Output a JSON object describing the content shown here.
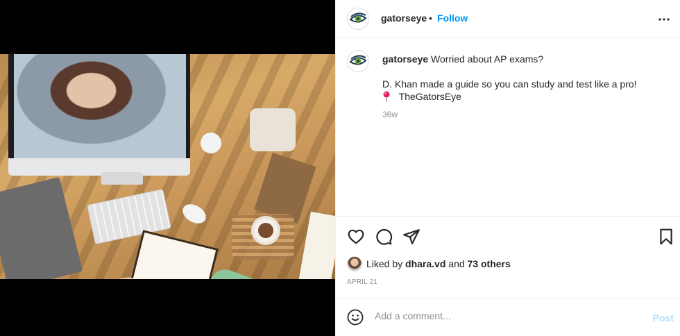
{
  "header": {
    "username": "gatorseye",
    "separator": "•",
    "follow_label": "Follow",
    "more_icon": "more-horizontal-icon"
  },
  "caption": {
    "username": "gatorseye",
    "line1": "Worried about AP exams?",
    "line2": "D. Khan made a guide so you can study and test like a pro!",
    "line3": "TheGatorsEye",
    "line3_icon": "round-pushpin-icon",
    "time": "36w"
  },
  "actions": {
    "like_icon": "heart-icon",
    "comment_icon": "comment-icon",
    "share_icon": "share-icon",
    "save_icon": "bookmark-icon"
  },
  "likes": {
    "prefix": "Liked by ",
    "user": "dhara.vd",
    "middle": " and ",
    "others": "73 others"
  },
  "date": "APRIL 21",
  "comment": {
    "placeholder": "Add a comment...",
    "post_label": "Post",
    "emoji_icon": "smiley-icon"
  },
  "colors": {
    "follow": "#0095f6",
    "post_disabled": "#b2dffc",
    "muted": "#8e8e8e",
    "text": "#262626"
  }
}
